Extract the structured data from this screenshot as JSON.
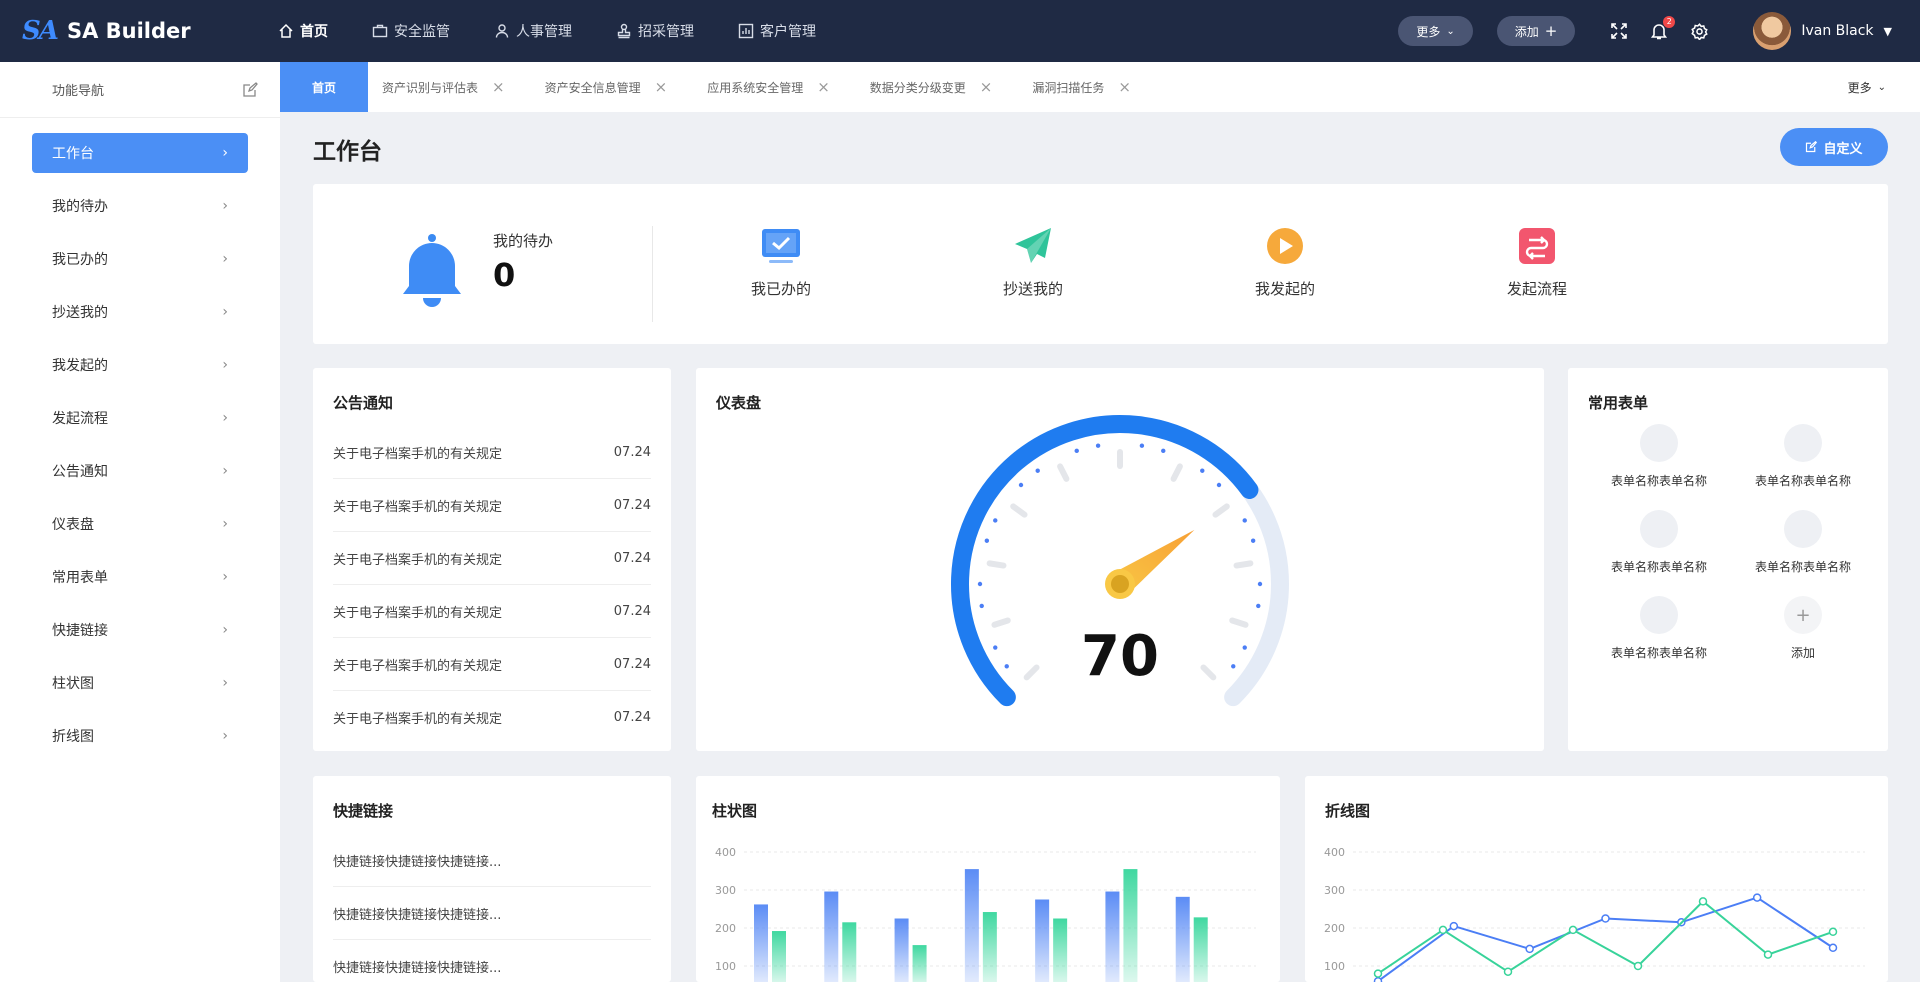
{
  "app": {
    "logo_mark": "SA",
    "title": "SA Builder"
  },
  "topnav": [
    {
      "label": "首页",
      "icon": "home-icon",
      "active": true
    },
    {
      "label": "安全监管",
      "icon": "briefcase-icon",
      "active": false
    },
    {
      "label": "人事管理",
      "icon": "user-icon",
      "active": false
    },
    {
      "label": "招采管理",
      "icon": "stamp-icon",
      "active": false
    },
    {
      "label": "客户管理",
      "icon": "chart-icon",
      "active": false
    }
  ],
  "topright": {
    "more_label": "更多",
    "add_label": "添加",
    "notification_count": "2",
    "user_name": "Ivan Black"
  },
  "sidebar": {
    "header": "功能导航",
    "items": [
      {
        "label": "工作台",
        "active": true
      },
      {
        "label": "我的待办"
      },
      {
        "label": "我已办的"
      },
      {
        "label": "抄送我的"
      },
      {
        "label": "我发起的"
      },
      {
        "label": "发起流程"
      },
      {
        "label": "公告通知"
      },
      {
        "label": "仪表盘"
      },
      {
        "label": "常用表单"
      },
      {
        "label": "快捷链接"
      },
      {
        "label": "柱状图"
      },
      {
        "label": "折线图"
      }
    ]
  },
  "tabs": [
    {
      "label": "首页",
      "active": true
    },
    {
      "label": "资产识别与评估表"
    },
    {
      "label": "资产安全信息管理"
    },
    {
      "label": "应用系统安全管理"
    },
    {
      "label": "数据分类分级变更"
    },
    {
      "label": "漏洞扫描任务"
    }
  ],
  "tabs_more": "更多",
  "page": {
    "title": "工作台",
    "customize_label": "自定义"
  },
  "todo": {
    "pending_label": "我的待办",
    "pending_count": "0",
    "items": [
      {
        "label": "我已办的",
        "icon": "monitor-check-icon",
        "color": "#3f8cf5"
      },
      {
        "label": "抄送我的",
        "icon": "paper-plane-icon",
        "color": "#2fc49a"
      },
      {
        "label": "我发起的",
        "icon": "play-circle-icon",
        "color": "#f6a93b"
      },
      {
        "label": "发起流程",
        "icon": "flow-icon",
        "color": "#f2566e"
      }
    ]
  },
  "notice": {
    "title": "公告通知",
    "rows": [
      {
        "text": "关于电子档案手机的有关规定",
        "date": "07.24"
      },
      {
        "text": "关于电子档案手机的有关规定",
        "date": "07.24"
      },
      {
        "text": "关于电子档案手机的有关规定",
        "date": "07.24"
      },
      {
        "text": "关于电子档案手机的有关规定",
        "date": "07.24"
      },
      {
        "text": "关于电子档案手机的有关规定",
        "date": "07.24"
      },
      {
        "text": "关于电子档案手机的有关规定",
        "date": "07.24"
      }
    ]
  },
  "gauge": {
    "title": "仪表盘",
    "value": 70,
    "value_label": "70",
    "max": 100,
    "colors": {
      "active": "#1f7cf0",
      "track": "#e4ebf6",
      "needle": "#f7a035"
    }
  },
  "forms": {
    "title": "常用表单",
    "items": [
      {
        "label": "表单名称表单名称"
      },
      {
        "label": "表单名称表单名称"
      },
      {
        "label": "表单名称表单名称"
      },
      {
        "label": "表单名称表单名称"
      },
      {
        "label": "表单名称表单名称"
      },
      {
        "label": "添加",
        "is_add": true,
        "symbol": "+"
      }
    ]
  },
  "links": {
    "title": "快捷链接",
    "rows": [
      {
        "text": "快捷链接快捷链接快捷链接..."
      },
      {
        "text": "快捷链接快捷链接快捷链接..."
      },
      {
        "text": "快捷链接快捷链接快捷链接..."
      }
    ]
  },
  "bar_chart": {
    "title": "柱状图",
    "chart_data": {
      "type": "bar",
      "y_ticks": [
        "400",
        "300",
        "200",
        "100"
      ],
      "ylim": [
        0,
        400
      ],
      "series": [
        {
          "color": "#5b8cf5",
          "values": [
            262,
            296,
            225,
            355,
            275,
            296,
            282
          ]
        },
        {
          "color": "#3fd8a0",
          "values": [
            192,
            215,
            155,
            242,
            225,
            355,
            228
          ]
        }
      ]
    }
  },
  "line_chart": {
    "title": "折线图",
    "chart_data": {
      "type": "line",
      "y_ticks": [
        "400",
        "300",
        "200",
        "100"
      ],
      "ylim": [
        0,
        400
      ],
      "series": [
        {
          "color": "#4b7ef5",
          "values": [
            60,
            205,
            145,
            225,
            215,
            280,
            148
          ]
        },
        {
          "color": "#38d39a",
          "values": [
            80,
            195,
            85,
            195,
            100,
            270,
            130,
            190
          ]
        }
      ]
    }
  }
}
